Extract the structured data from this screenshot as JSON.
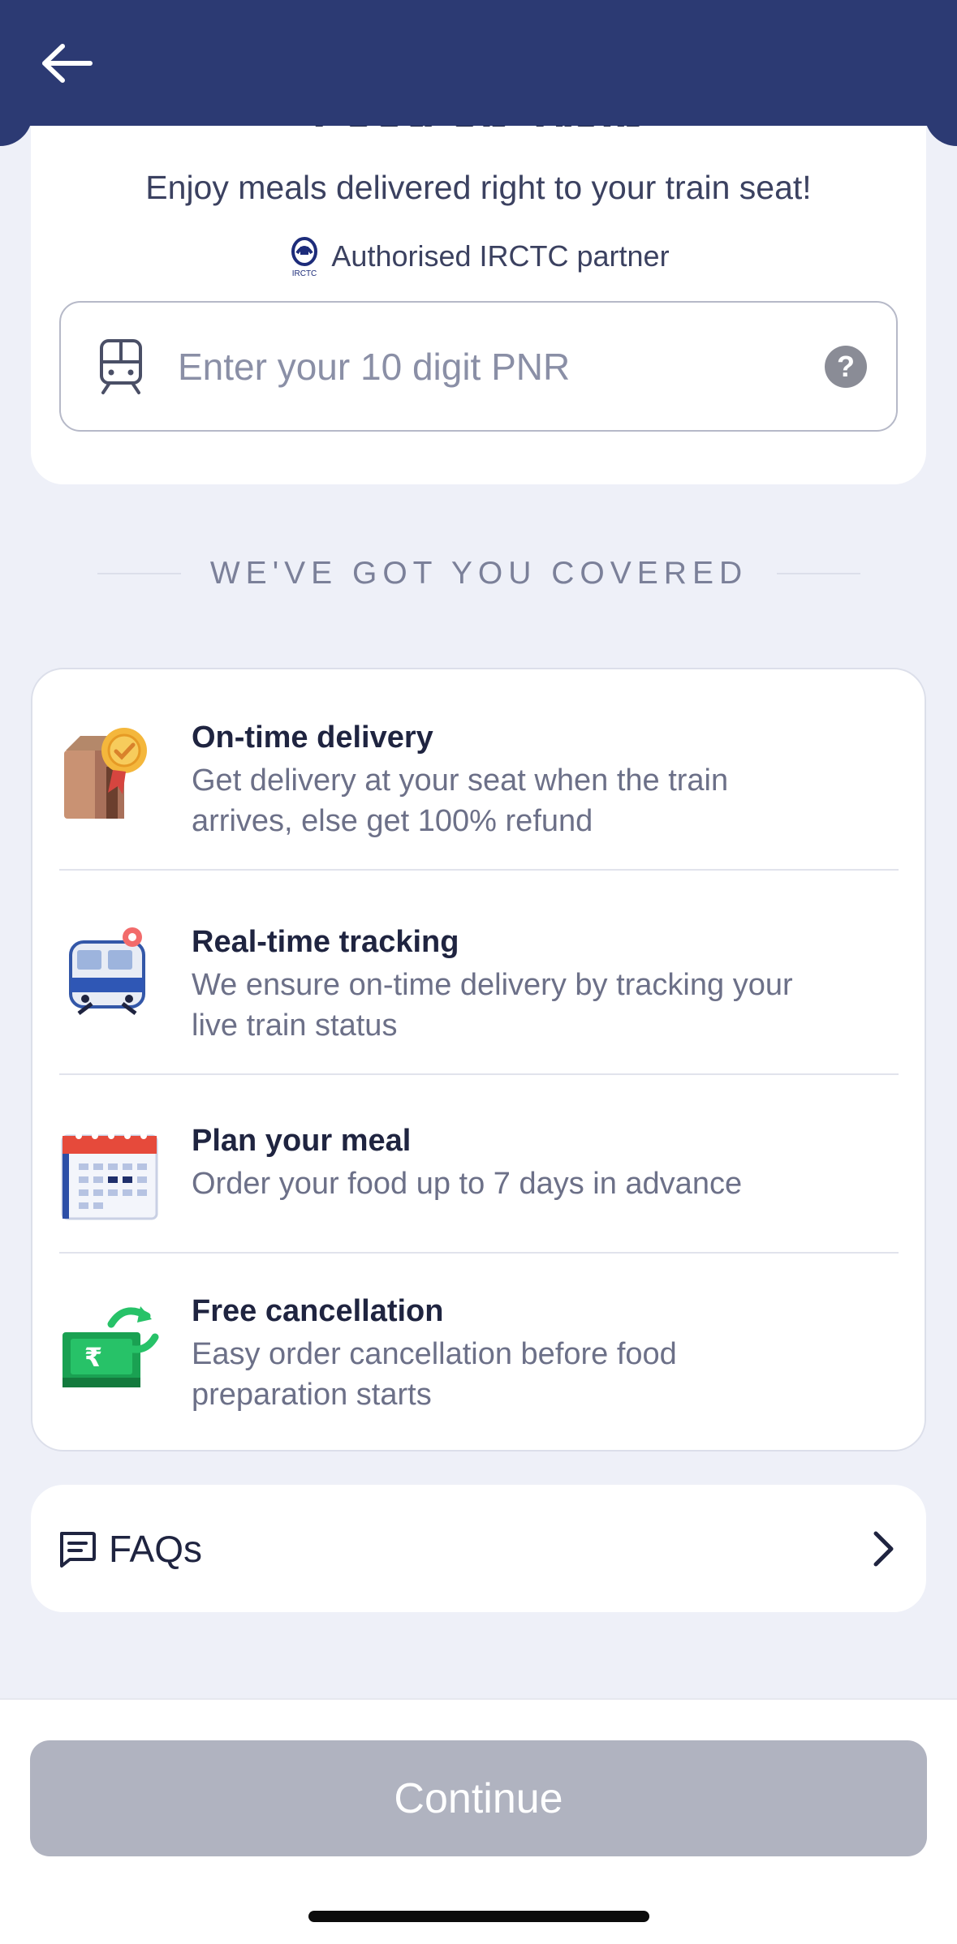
{
  "header": {
    "back_icon": "arrow-left-icon",
    "bg_color": "#2c3a73"
  },
  "hero": {
    "title": "Food on Train",
    "subtitle": "Enjoy meals delivered right to your train seat!",
    "partner_text": "Authorised IRCTC partner",
    "partner_logo_text": "IRCTC",
    "pnr_placeholder": "Enter your 10 digit PNR",
    "pnr_value": "",
    "help_glyph": "?"
  },
  "section": {
    "heading": "WE'VE GOT YOU COVERED"
  },
  "features": [
    {
      "title": "On-time delivery",
      "desc_line1": "Get delivery at your seat when the train",
      "desc_line2": "arrives, else get 100% refund",
      "icon": "food-bag-badge-icon"
    },
    {
      "title": "Real-time tracking",
      "desc_line1": "We ensure on-time delivery by tracking your",
      "desc_line2": "live train status",
      "icon": "train-tracking-icon"
    },
    {
      "title": "Plan your meal",
      "desc_line1": "Order your food up to 7 days in advance",
      "icon": "calendar-icon"
    },
    {
      "title": "Free cancellation",
      "desc_line1": "Easy order cancellation before food",
      "desc_line2": "preparation starts",
      "icon": "refund-cash-icon",
      "currency_glyph": "₹"
    }
  ],
  "faq": {
    "label": "FAQs",
    "icon": "chat-icon",
    "chevron": "chevron-right-icon"
  },
  "footer": {
    "continue_label": "Continue",
    "button_color": "#b0b3c0"
  }
}
